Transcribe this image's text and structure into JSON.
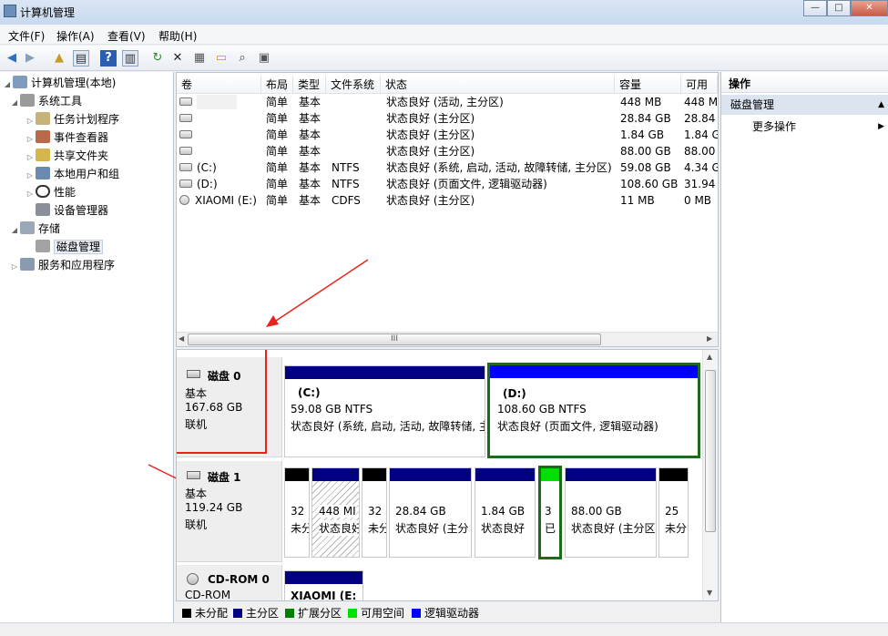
{
  "window": {
    "title": "计算机管理",
    "min": "—",
    "max": "□",
    "close": "✕"
  },
  "menu": [
    "文件(F)",
    "操作(A)",
    "查看(V)",
    "帮助(H)"
  ],
  "tree": {
    "root": "计算机管理(本地)",
    "system_tools": "系统工具",
    "task_scheduler": "任务计划程序",
    "event_viewer": "事件查看器",
    "shared_folders": "共享文件夹",
    "local_users": "本地用户和组",
    "performance": "性能",
    "device_manager": "设备管理器",
    "storage": "存储",
    "disk_management": "磁盘管理",
    "services_apps": "服务和应用程序"
  },
  "volumes": {
    "headers": [
      "卷",
      "布局",
      "类型",
      "文件系统",
      "状态",
      "容量",
      "可用空"
    ],
    "rows": [
      [
        "",
        "简单",
        "基本",
        "",
        "状态良好 (活动, 主分区)",
        "448 MB",
        "448 M"
      ],
      [
        "",
        "简单",
        "基本",
        "",
        "状态良好 (主分区)",
        "28.84 GB",
        "28.84 G"
      ],
      [
        "",
        "简单",
        "基本",
        "",
        "状态良好 (主分区)",
        "1.84 GB",
        "1.84 G"
      ],
      [
        "",
        "简单",
        "基本",
        "",
        "状态良好 (主分区)",
        "88.00 GB",
        "88.00 G"
      ],
      [
        "(C:)",
        "简单",
        "基本",
        "NTFS",
        "状态良好 (系统, 启动, 活动, 故障转储, 主分区)",
        "59.08 GB",
        "4.34 G"
      ],
      [
        "(D:)",
        "简单",
        "基本",
        "NTFS",
        "状态良好 (页面文件, 逻辑驱动器)",
        "108.60 GB",
        "31.94 G"
      ],
      [
        "XIAOMI (E:)",
        "简单",
        "基本",
        "CDFS",
        "状态良好 (主分区)",
        "11 MB",
        "0 MB"
      ]
    ],
    "scroll_grip": "III"
  },
  "disks": {
    "disk0": {
      "name": "磁盘 0",
      "type": "基本",
      "size": "167.68 GB",
      "state": "联机",
      "c": {
        "name": "(C:)",
        "size": "59.08 GB NTFS",
        "status": "状态良好 (系统, 启动, 活动, 故障转储, 主"
      },
      "d": {
        "name": "(D:)",
        "size": "108.60 GB NTFS",
        "status": "状态良好 (页面文件, 逻辑驱动器)"
      }
    },
    "disk1": {
      "name": "磁盘 1",
      "type": "基本",
      "size": "119.24 GB",
      "state": "联机",
      "p1": {
        "l1": "32",
        "l2": "未分"
      },
      "p2": {
        "l1": "448 MI",
        "l2": "状态良好"
      },
      "p3": {
        "l1": "32",
        "l2": "未分"
      },
      "p4": {
        "l1": "28.84 GB",
        "l2": "状态良好 (主分"
      },
      "p5": {
        "l1": "1.84 GB",
        "l2": "状态良好"
      },
      "p6": {
        "l1": "3",
        "l2": "已"
      },
      "p7": {
        "l1": "88.00 GB",
        "l2": "状态良好 (主分区"
      },
      "p8": {
        "l1": "25",
        "l2": "未分"
      }
    },
    "cdrom": {
      "name": "CD-ROM 0",
      "type": "CD-ROM",
      "vol": "XIAOMI  (E:"
    }
  },
  "legend": [
    "未分配",
    "主分区",
    "扩展分区",
    "可用空间",
    "逻辑驱动器"
  ],
  "colors": {
    "unallocated": "#000000",
    "primary": "#000080",
    "extended": "#008000",
    "free": "#00e000",
    "logical": "#0000ff"
  },
  "actions": {
    "title": "操作",
    "section": "磁盘管理",
    "more": "更多操作"
  }
}
